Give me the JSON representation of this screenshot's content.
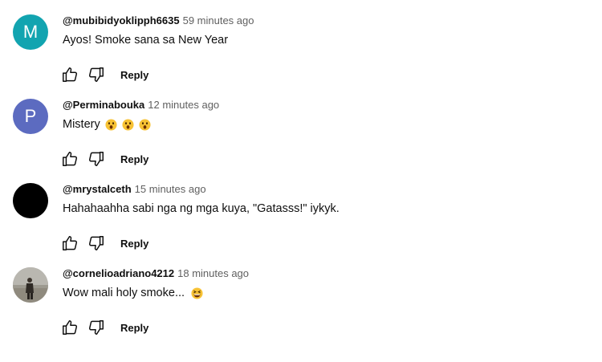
{
  "reply_label": "Reply",
  "comments": [
    {
      "author": "@mubibidyoklipph6635",
      "time": "59 minutes ago",
      "text": "Ayos! Smoke sana sa New Year",
      "avatar_letter": "M",
      "avatar_color": "#12a4b0"
    },
    {
      "author": "@Perminabouka",
      "time": "12 minutes ago",
      "text": "Mistery",
      "avatar_letter": "P",
      "avatar_color": "#5c6bc0",
      "emojis": [
        "astonished-face-emoji",
        "astonished-face-emoji",
        "astonished-face-emoji"
      ]
    },
    {
      "author": "@mrystalceth",
      "time": "15 minutes ago",
      "text": "Hahahaahha sabi nga ng mga kuya, \"Gatasss!\" iykyk.",
      "avatar_color": "#000000"
    },
    {
      "author": "@cornelioadriano4212",
      "time": "18 minutes ago",
      "text": "Wow mali holy smoke...",
      "avatar_color": "#a8a49c",
      "emojis": [
        "grinning-squinting-face-emoji"
      ]
    }
  ]
}
